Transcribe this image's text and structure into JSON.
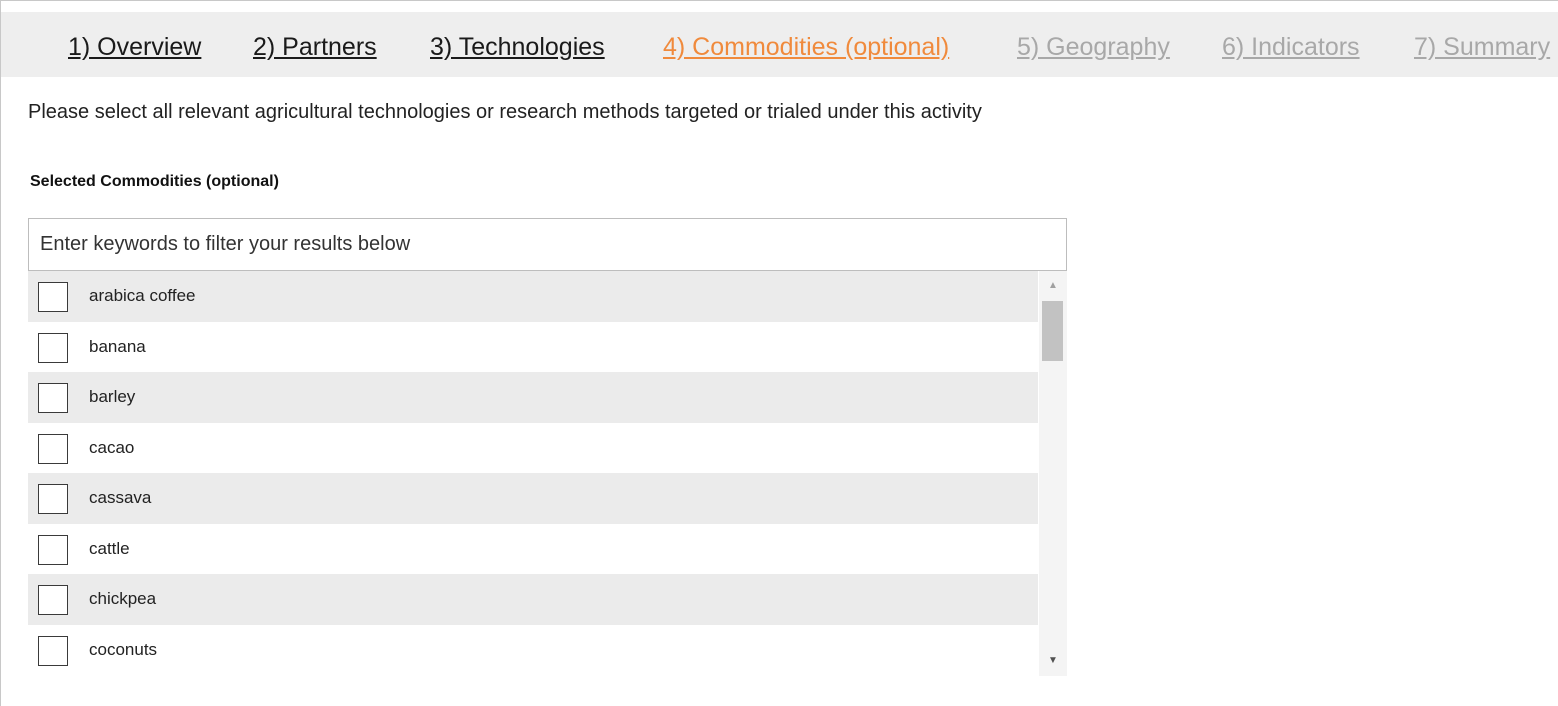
{
  "tabs": [
    {
      "label": "1) Overview",
      "state": "done"
    },
    {
      "label": "2) Partners",
      "state": "done"
    },
    {
      "label": "3) Technologies",
      "state": "done"
    },
    {
      "label": "4) Commodities (optional)",
      "state": "active"
    },
    {
      "label": "5) Geography",
      "state": "disabled"
    },
    {
      "label": "6) Indicators",
      "state": "disabled"
    },
    {
      "label": "7) Summary",
      "state": "disabled"
    }
  ],
  "instructions": "Please select all relevant agricultural technologies or research methods targeted or trialed under this activity",
  "section_label": "Selected Commodities (optional)",
  "filter": {
    "placeholder": "Enter keywords to filter your results below",
    "value": ""
  },
  "commodities": [
    {
      "label": "arabica coffee",
      "checked": false
    },
    {
      "label": "banana",
      "checked": false
    },
    {
      "label": "barley",
      "checked": false
    },
    {
      "label": "cacao",
      "checked": false
    },
    {
      "label": "cassava",
      "checked": false
    },
    {
      "label": "cattle",
      "checked": false
    },
    {
      "label": "chickpea",
      "checked": false
    },
    {
      "label": "coconuts",
      "checked": false
    }
  ],
  "scrollbar": {
    "up_icon": "scroll-up-arrow-icon",
    "down_icon": "scroll-down-arrow-icon"
  },
  "colors": {
    "tab_done": "#1a1a1a",
    "tab_active": "#f08a3c",
    "tab_disabled": "#a8a8a8",
    "tabbar_background": "#eeeeee",
    "row_striped": "#ebebeb"
  }
}
